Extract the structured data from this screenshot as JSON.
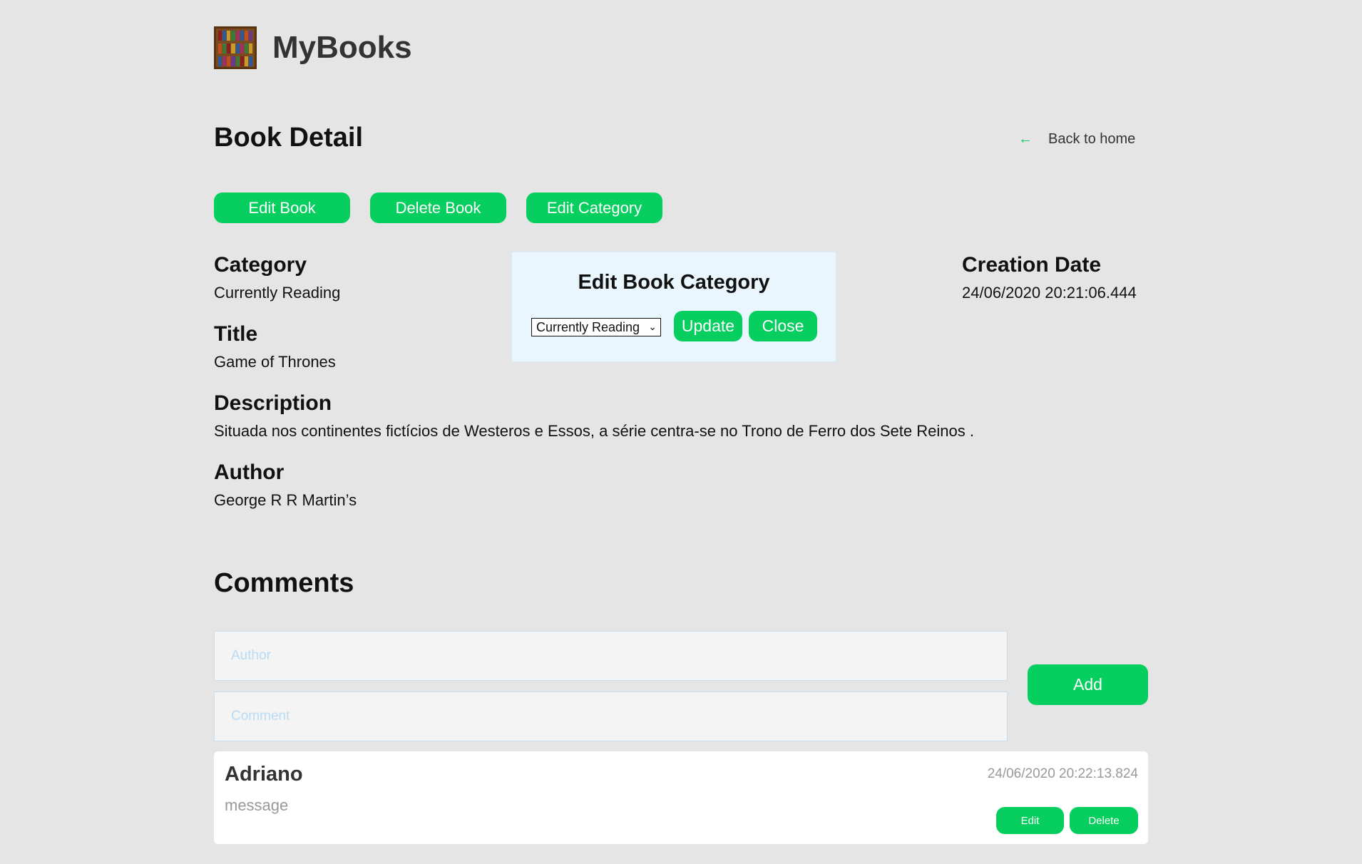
{
  "header": {
    "app_title": "MyBooks",
    "logo_icon": "bookshelf-icon"
  },
  "page": {
    "title": "Book Detail",
    "back_label": "Back to home",
    "back_icon": "arrow-left-icon"
  },
  "actions": {
    "edit_book": "Edit Book",
    "delete_book": "Delete Book",
    "edit_category": "Edit Category"
  },
  "book": {
    "category_label": "Category",
    "category": "Currently Reading",
    "title_label": "Title",
    "title": "Game of Thrones",
    "description_label": "Description",
    "description": "Situada nos continentes fictícios de Westeros e Essos, a série centra-se no Trono de Ferro dos Sete Reinos .",
    "author_label": "Author",
    "author": "George R R Martin’s",
    "creation_date_label": "Creation Date",
    "creation_date": "24/06/2020 20:21:06.444"
  },
  "modal": {
    "title": "Edit Book Category",
    "selected_option": "Currently Reading",
    "update_label": "Update",
    "close_label": "Close"
  },
  "comments": {
    "title": "Comments",
    "author_placeholder": "Author",
    "comment_placeholder": "Comment",
    "add_label": "Add",
    "items": [
      {
        "author": "Adriano",
        "date": "24/06/2020 20:22:13.824",
        "message": "message",
        "edit_label": "Edit",
        "delete_label": "Delete"
      }
    ]
  },
  "colors": {
    "accent": "#06cf5f",
    "background": "#e5e5e5",
    "modal_bg": "#e9f6fd"
  }
}
